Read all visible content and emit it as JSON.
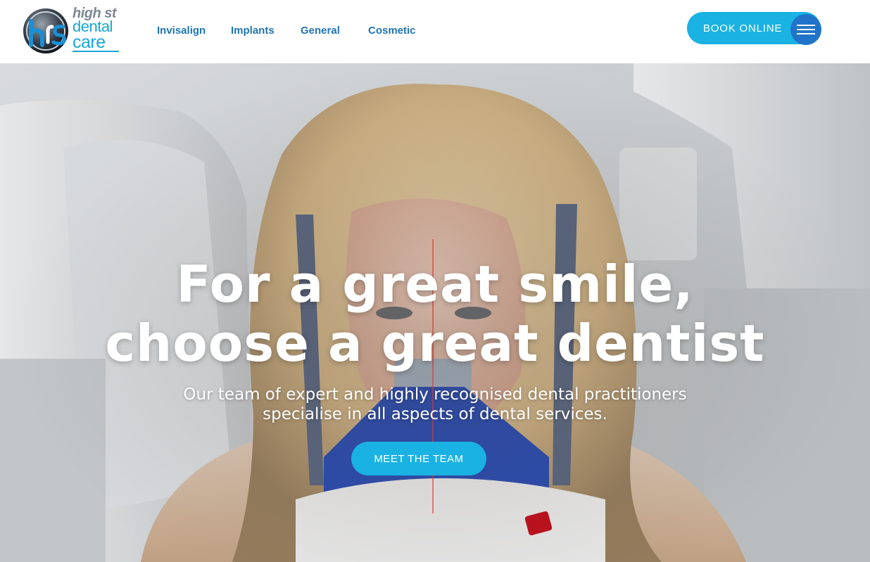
{
  "brand": {
    "line1": "high st",
    "line2": "dental",
    "line3": "care",
    "colors": {
      "accent": "#1ab2e3",
      "nav": "#1f74b6",
      "logo_grey": "#7d8894"
    }
  },
  "nav": {
    "items": [
      {
        "label": "Invisalign"
      },
      {
        "label": "Implants"
      },
      {
        "label": "General"
      },
      {
        "label": "Cosmetic"
      }
    ]
  },
  "header": {
    "book_label": "BOOK ONLINE",
    "menu_icon": "hamburger-icon"
  },
  "hero": {
    "title_line1": "For a great smile,",
    "title_line2": "choose a great dentist",
    "subtitle_line1": "Our team of expert and highly recognised dental practitioners",
    "subtitle_line2": "specialise in all aspects of dental services.",
    "cta_label": "MEET THE TEAM"
  }
}
